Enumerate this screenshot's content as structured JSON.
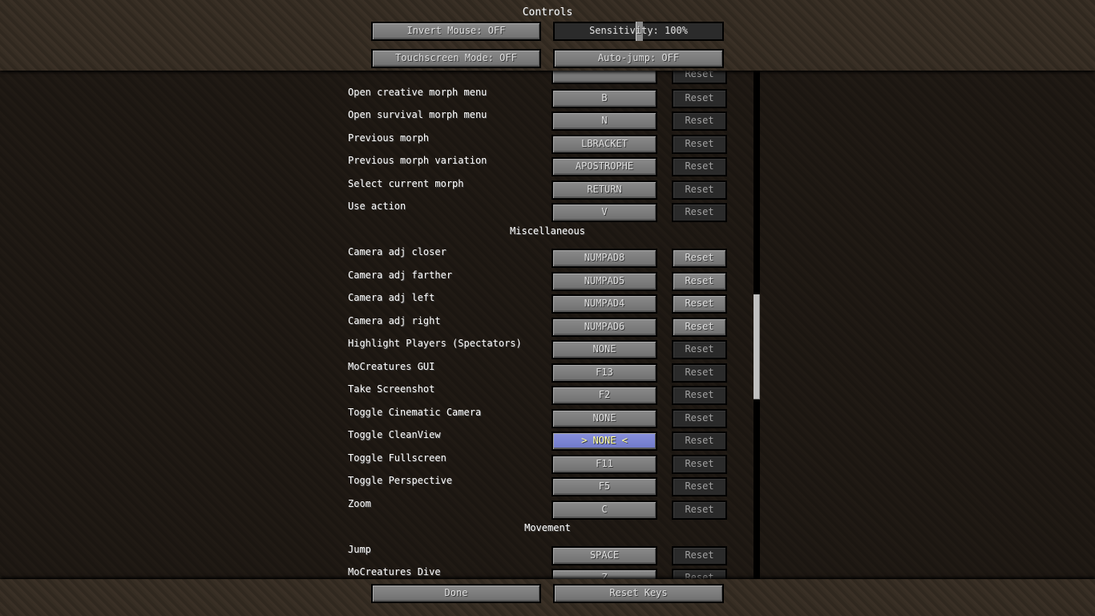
{
  "header": {
    "title": "Controls",
    "invert_mouse": "Invert Mouse: OFF",
    "sensitivity": "Sensitivity: 100%",
    "sensitivity_value": 100,
    "touchscreen": "Touchscreen Mode: OFF",
    "auto_jump": "Auto-jump: OFF"
  },
  "reset_label": "Reset",
  "entries": [
    {
      "type": "row",
      "label": "",
      "key": "",
      "reset_enabled": false
    },
    {
      "type": "row",
      "label": "Open creative morph menu",
      "key": "B",
      "reset_enabled": false
    },
    {
      "type": "row",
      "label": "Open survival morph menu",
      "key": "N",
      "reset_enabled": false
    },
    {
      "type": "row",
      "label": "Previous morph",
      "key": "LBRACKET",
      "reset_enabled": false
    },
    {
      "type": "row",
      "label": "Previous morph variation",
      "key": "APOSTROPHE",
      "reset_enabled": false
    },
    {
      "type": "row",
      "label": "Select current morph",
      "key": "RETURN",
      "reset_enabled": false
    },
    {
      "type": "row",
      "label": "Use action",
      "key": "V",
      "reset_enabled": false
    },
    {
      "type": "category",
      "label": "Miscellaneous"
    },
    {
      "type": "row",
      "label": "Camera adj closer",
      "key": "NUMPAD8",
      "reset_enabled": true
    },
    {
      "type": "row",
      "label": "Camera adj farther",
      "key": "NUMPAD5",
      "reset_enabled": true
    },
    {
      "type": "row",
      "label": "Camera adj left",
      "key": "NUMPAD4",
      "reset_enabled": true
    },
    {
      "type": "row",
      "label": "Camera adj right",
      "key": "NUMPAD6",
      "reset_enabled": true
    },
    {
      "type": "row",
      "label": "Highlight Players (Spectators)",
      "key": "NONE",
      "reset_enabled": false
    },
    {
      "type": "row",
      "label": "MoCreatures GUI",
      "key": "F13",
      "reset_enabled": false
    },
    {
      "type": "row",
      "label": "Take Screenshot",
      "key": "F2",
      "reset_enabled": false
    },
    {
      "type": "row",
      "label": "Toggle Cinematic Camera",
      "key": "NONE",
      "reset_enabled": false
    },
    {
      "type": "row",
      "label": "Toggle CleanView",
      "key": "> NONE <",
      "reset_enabled": false,
      "selected": true
    },
    {
      "type": "row",
      "label": "Toggle Fullscreen",
      "key": "F11",
      "reset_enabled": false
    },
    {
      "type": "row",
      "label": "Toggle Perspective",
      "key": "F5",
      "reset_enabled": false
    },
    {
      "type": "row",
      "label": "Zoom",
      "key": "C",
      "reset_enabled": false
    },
    {
      "type": "category",
      "label": "Movement"
    },
    {
      "type": "row",
      "label": "Jump",
      "key": "SPACE",
      "reset_enabled": false
    },
    {
      "type": "row",
      "label": "MoCreatures Dive",
      "key": "Z",
      "reset_enabled": false
    }
  ],
  "footer": {
    "done": "Done",
    "reset_keys": "Reset Keys"
  },
  "colors": {
    "selected_button": "#7880cc",
    "selected_text": "#ffffa0"
  }
}
